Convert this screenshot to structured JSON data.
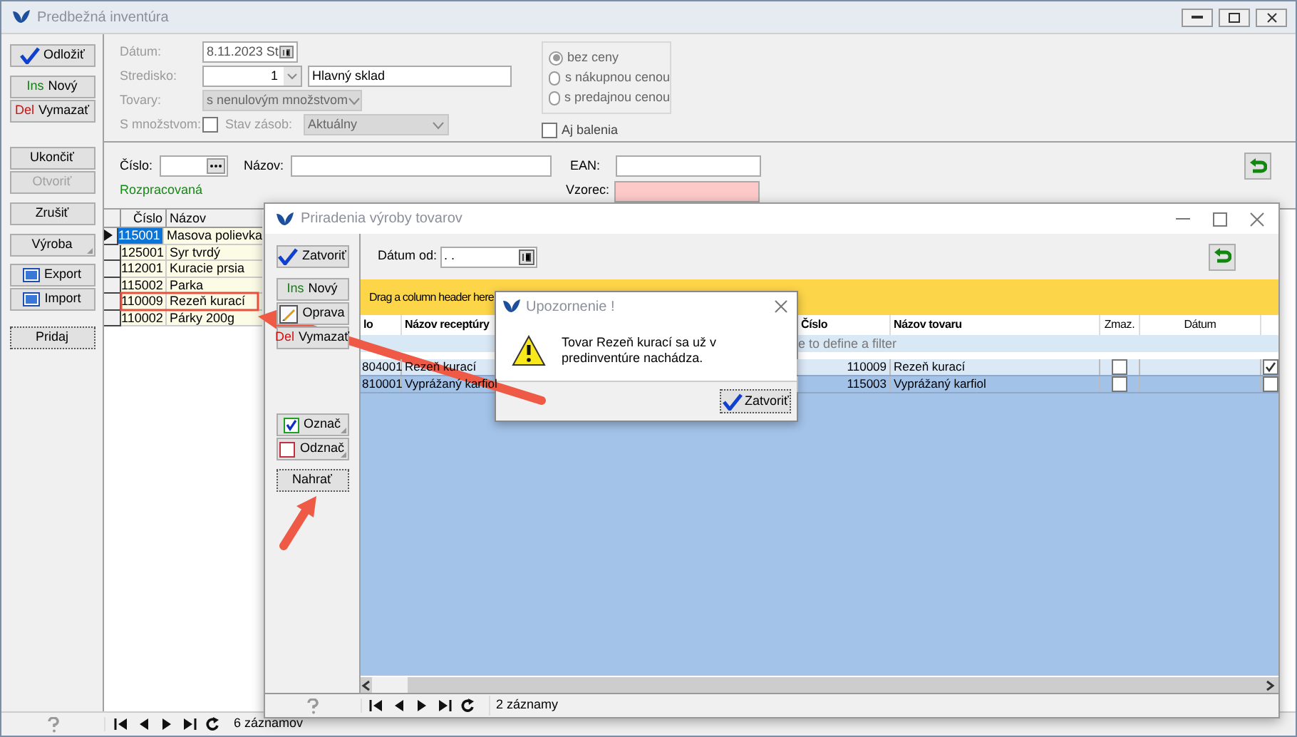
{
  "main_window": {
    "title": "Predbežná inventúra",
    "button_groups": [
      [
        {
          "kind": "check",
          "label": "Odložiť",
          "disabled": false
        }
      ],
      [
        {
          "kind": "ins",
          "key": "Ins",
          "label": "Nový",
          "disabled": false
        },
        {
          "kind": "del",
          "key": "Del",
          "label": "Vymazať",
          "disabled": false
        }
      ],
      [
        {
          "kind": "plain",
          "label": "Ukončiť",
          "disabled": false
        },
        {
          "kind": "plain",
          "label": "Otvoriť",
          "disabled": true
        }
      ],
      [
        {
          "kind": "plain",
          "label": "Zrušiť",
          "disabled": false
        }
      ],
      [
        {
          "kind": "menu",
          "label": "Výroba",
          "disabled": false
        }
      ],
      [
        {
          "kind": "export",
          "label": "Export",
          "disabled": false
        },
        {
          "kind": "export",
          "label": "Import",
          "disabled": false
        }
      ],
      [
        {
          "kind": "focused",
          "label": "Pridaj",
          "disabled": false
        }
      ]
    ],
    "form": {
      "disabled": true,
      "datum": {
        "label": "Dátum:",
        "value": "8.11.2023 St"
      },
      "stredisko": {
        "label": "Stredisko:",
        "number": "1",
        "name": "Hlavný sklad"
      },
      "tovary": {
        "label": "Tovary:",
        "value": "s nenulovým množstvom"
      },
      "s_mnozstvom": {
        "label": "S množstvom:",
        "checked": false
      },
      "stav_zasob": {
        "label": "Stav zásob:",
        "value": "Aktuálny"
      },
      "price_options": [
        {
          "label": "bez ceny",
          "selected": true
        },
        {
          "label": "s nákupnou cenou",
          "selected": false
        },
        {
          "label": "s predajnou cenou",
          "selected": false
        }
      ],
      "aj_balenia": {
        "label": "Aj balenia",
        "checked": false
      }
    },
    "filter": {
      "cislo_label": "Číslo:",
      "nazov_label": "Názov:",
      "ean_label": "EAN:",
      "vzorec_label": "Vzorec:",
      "status": "Rozpracovaná"
    },
    "grid": {
      "columns": [
        "Číslo",
        "Názov"
      ],
      "rows": [
        {
          "cislo": "115001",
          "nazov": "Masova polievka",
          "selected": true
        },
        {
          "cislo": "125001",
          "nazov": "Syr tvrdý",
          "selected": false
        },
        {
          "cislo": "112001",
          "nazov": "Kuracie prsia",
          "selected": false
        },
        {
          "cislo": "115002",
          "nazov": "Parka",
          "selected": false
        },
        {
          "cislo": "110009",
          "nazov": "Rezeň kurací",
          "selected": false
        },
        {
          "cislo": "110002",
          "nazov": "Párky 200g",
          "selected": false
        }
      ]
    },
    "status_bar": {
      "count": "6 záznamov"
    }
  },
  "child_window": {
    "title": "Priradenia výroby tovarov",
    "button_groups": [
      [
        {
          "kind": "check",
          "label": "Zatvoriť"
        }
      ],
      [
        {
          "kind": "ins",
          "key": "Ins",
          "label": "Nový"
        },
        {
          "kind": "edit",
          "label": "Oprava"
        },
        {
          "kind": "del",
          "key": "Del",
          "label": "Vymazať"
        }
      ],
      [
        {
          "kind": "mark",
          "label": "Označ"
        },
        {
          "kind": "unmark",
          "label": "Odznač"
        }
      ],
      [
        {
          "kind": "focused",
          "label": "Nahrať"
        }
      ]
    ],
    "date_from": {
      "label": "Dátum od:",
      "value": ". ."
    },
    "group_panel_hint": "Drag a column header here",
    "columns": [
      "lo",
      "Názov receptúry",
      "Číslo",
      "Názov tovaru",
      "Zmaz.",
      "Dátum"
    ],
    "filter_hint": "e to define a filter",
    "rows": [
      {
        "col_1": "804001",
        "recipe": "Rezeň kurací",
        "cislo": "110009",
        "product": "Rezeň kurací",
        "deleted": false,
        "checked": true,
        "selected": false
      },
      {
        "col_1": "810001",
        "recipe": "Vyprážaný karfiol",
        "cislo": "115003",
        "product": "Vyprážaný karfiol",
        "deleted": false,
        "checked": false,
        "selected": true
      }
    ],
    "status": "2 záznamy"
  },
  "dialog": {
    "title": "Upozornenie !",
    "message": "Tovar Rezeň kurací sa už v predinventúre nachádza.",
    "button": "Zatvoriť"
  }
}
